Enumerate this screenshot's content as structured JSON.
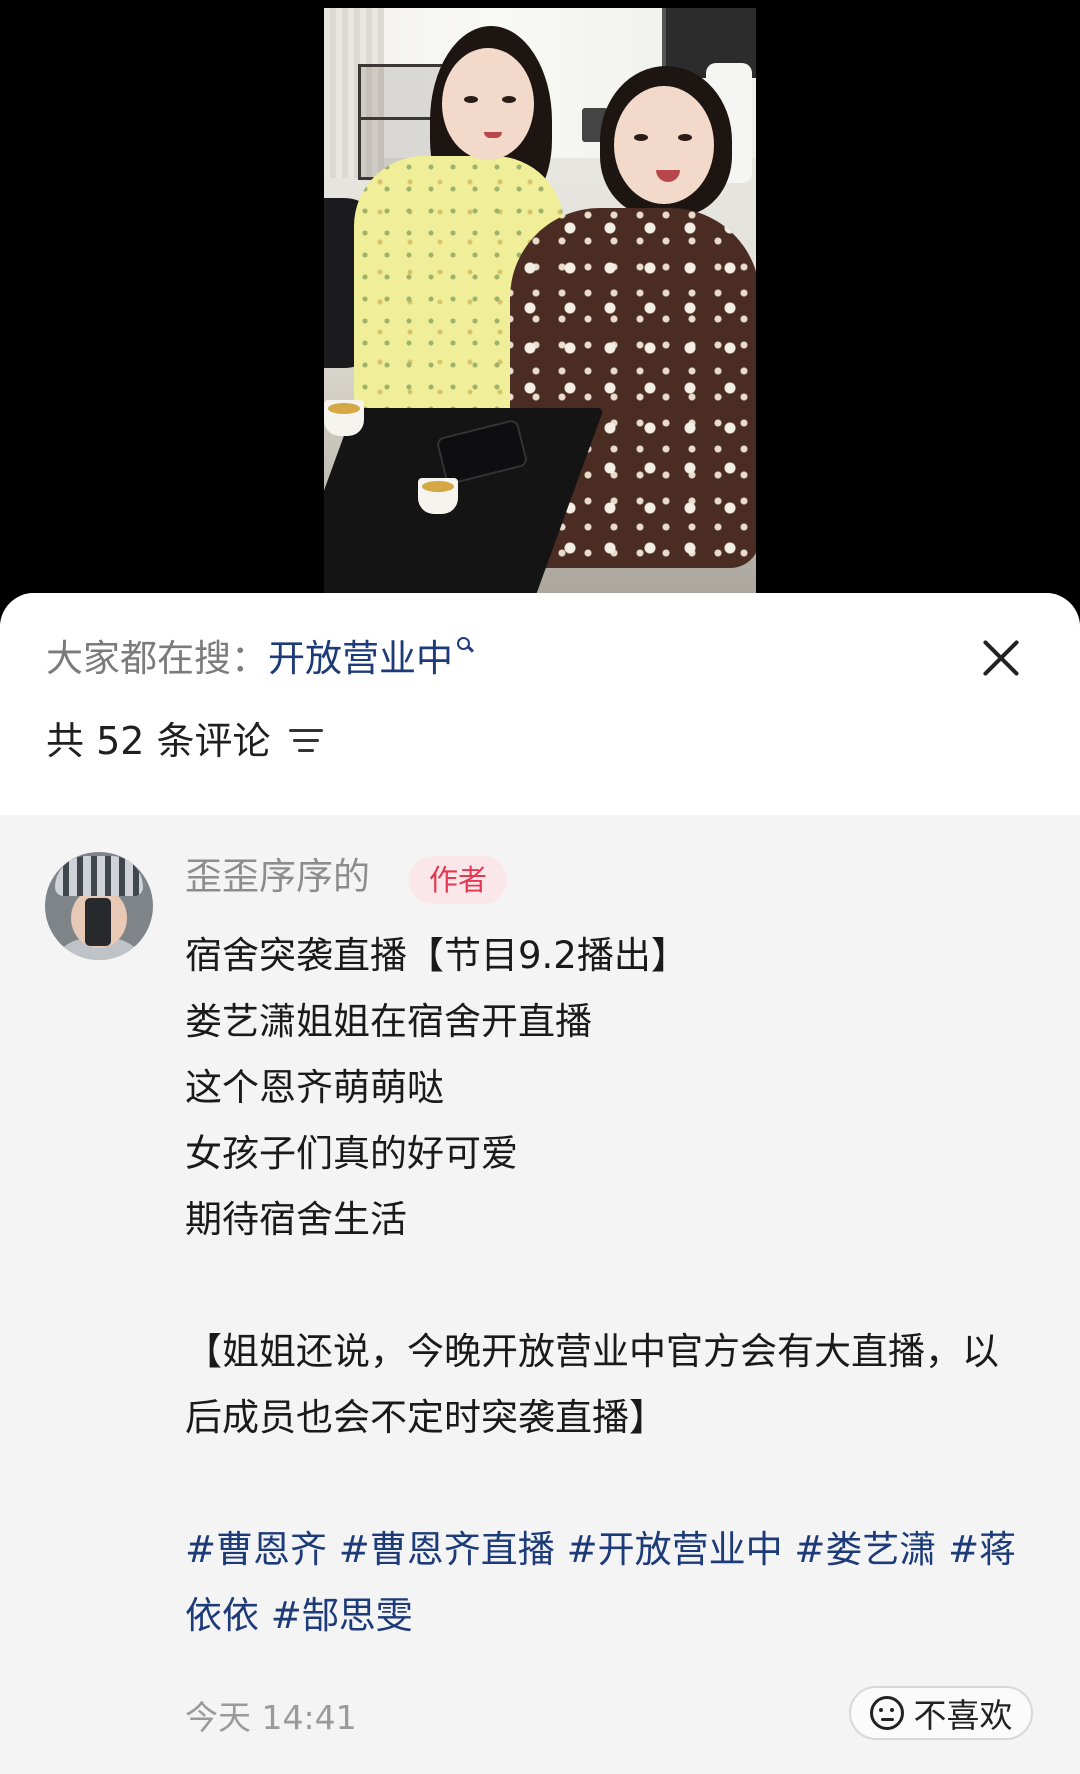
{
  "search": {
    "label": "大家都在搜",
    "separator": "：",
    "keyword": "开放营业中",
    "icon": "search-icon"
  },
  "comments": {
    "count_text": "共 52 条评论",
    "sort_icon": "filter-sort-icon"
  },
  "comment": {
    "username": "歪歪序序的",
    "badge": "作者",
    "lines": [
      "宿舍突袭直播【节目9.2播出】",
      "娄艺潇姐姐在宿舍开直播",
      "这个恩齐萌萌哒",
      "女孩子们真的好可爱",
      "期待宿舍生活"
    ],
    "note": "【姐姐还说，今晚开放营业中官方会有大直播，以后成员也会不定时突袭直播】",
    "hashtags": [
      "#曹恩齐",
      "#曹恩齐直播",
      "#开放营业中",
      "#娄艺潇",
      "#蒋依依",
      "#郜思雯"
    ],
    "time": "今天 14:41",
    "dislike_label": "不喜欢"
  },
  "colors": {
    "keyword": "#1d3b78",
    "badge_bg": "#fbe7ea",
    "badge_text": "#e23a52",
    "comment_bg": "#f4f4f5"
  }
}
